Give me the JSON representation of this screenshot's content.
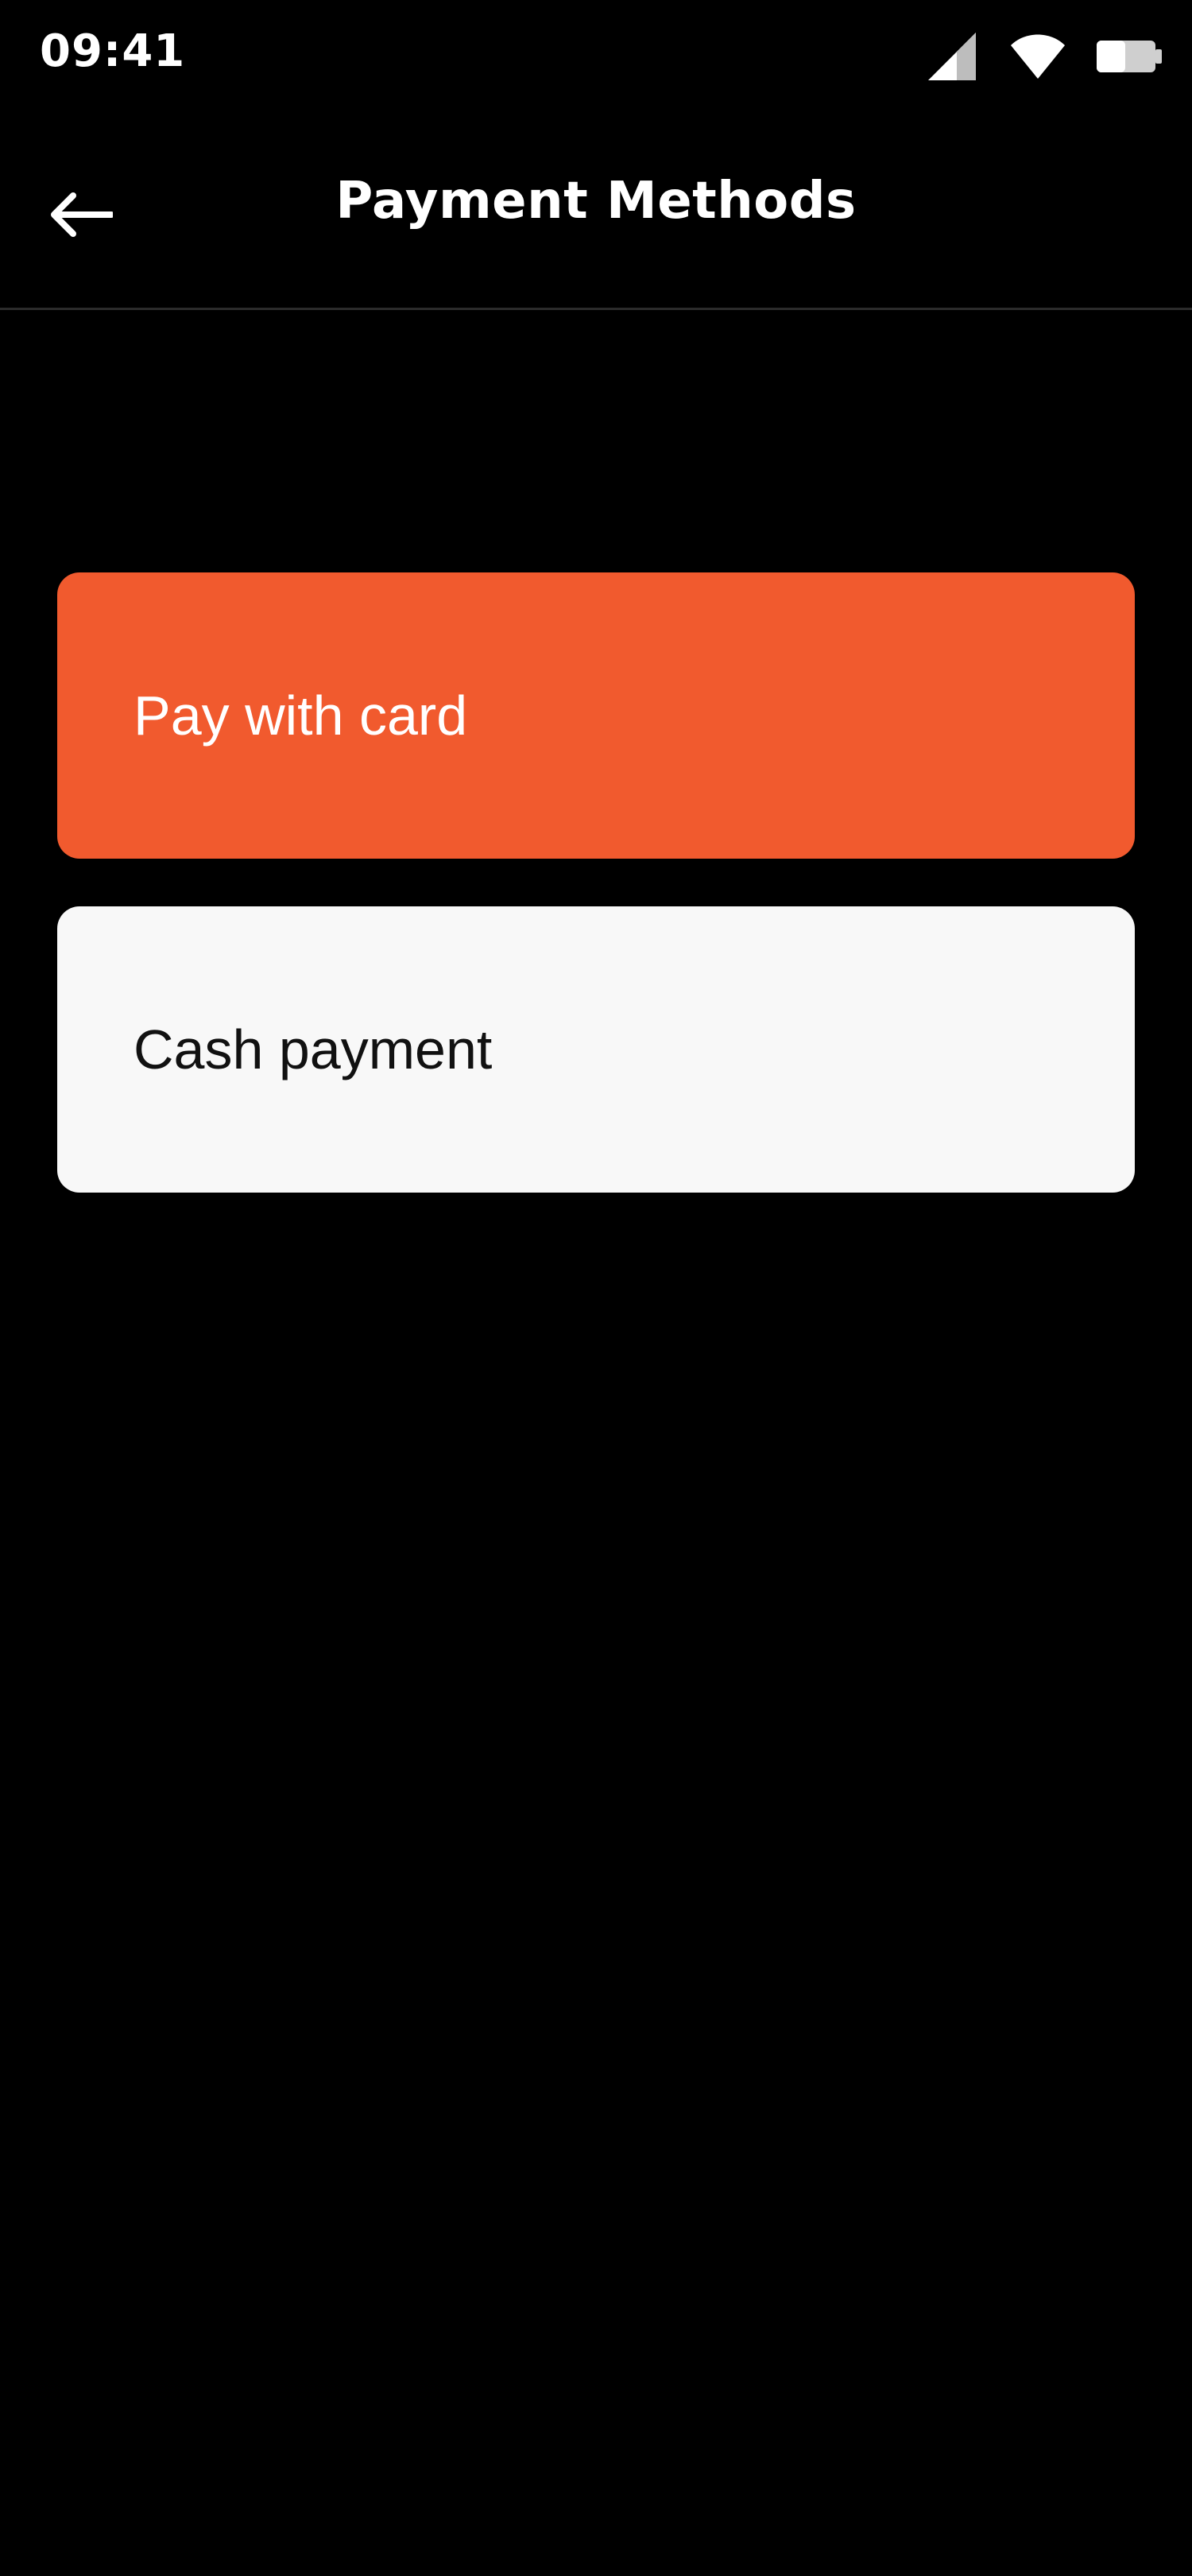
{
  "status_bar": {
    "time": "09:41",
    "icons": [
      "signal-icon",
      "wifi-icon",
      "battery-icon"
    ]
  },
  "header": {
    "back_icon": "arrow-left-icon",
    "title": "Payment Methods"
  },
  "payment_options": [
    {
      "label": "Pay with card",
      "selected": true
    },
    {
      "label": "Cash payment",
      "selected": false
    }
  ],
  "colors": {
    "background": "#000000",
    "accent": "#F15A2E",
    "option_default": "#F8F8F8",
    "divider": "#2B2B2B"
  }
}
